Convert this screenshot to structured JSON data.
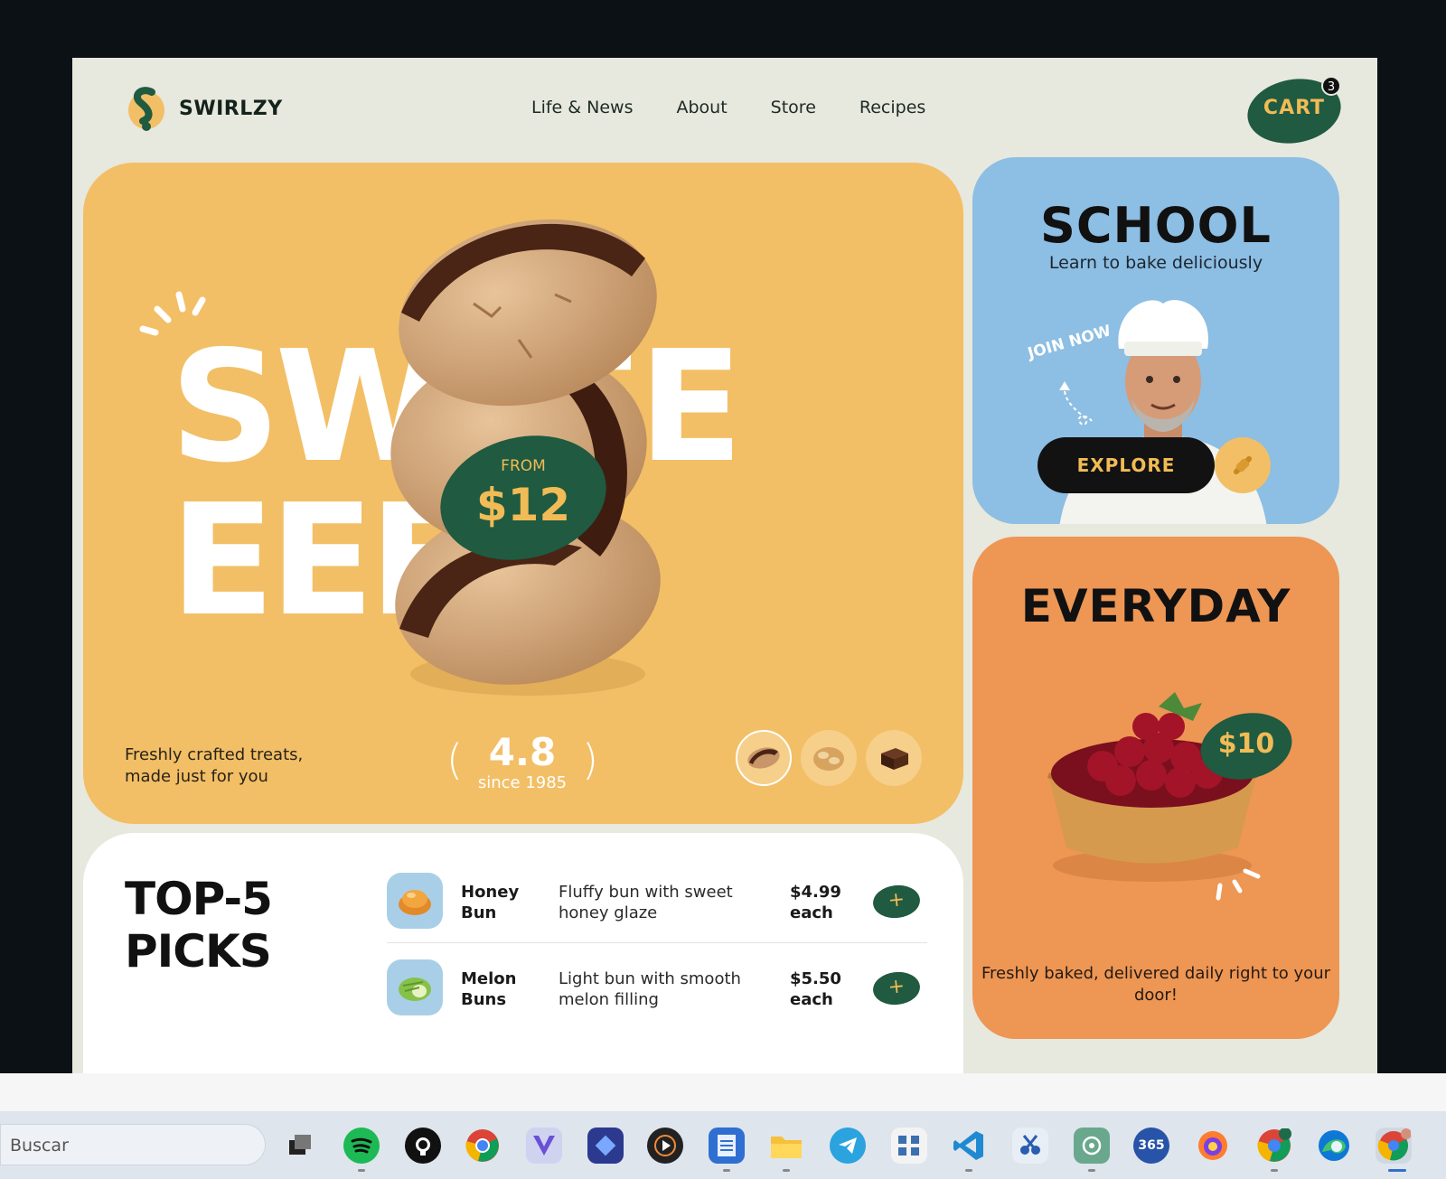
{
  "brand": {
    "name": "SWIRLZY"
  },
  "nav": [
    {
      "label": "Life & News"
    },
    {
      "label": "About"
    },
    {
      "label": "Store"
    },
    {
      "label": "Recipes"
    }
  ],
  "cart": {
    "label": "CART",
    "count": "3"
  },
  "hero": {
    "word_line1": "SWEEE",
    "word_line2": "EEET!",
    "price_from": "FROM",
    "price": "$12",
    "tagline": "Freshly crafted treats, made just for you",
    "rating": "4.8",
    "rating_sub": "since 1985",
    "thumbs": [
      "cookie-thumb-icon",
      "croissant-thumb-icon",
      "brownie-thumb-icon"
    ]
  },
  "picks": {
    "title_line1": "TOP-5",
    "title_line2": "PICKS",
    "items": [
      {
        "name": "Honey Bun",
        "desc": "Fluffy bun with sweet honey glaze",
        "price": "$4.99 each",
        "add": "+"
      },
      {
        "name": "Melon Buns",
        "desc": "Light bun with smooth melon filling",
        "price": "$5.50 each",
        "add": "+"
      }
    ]
  },
  "school": {
    "title": "SCHOOL",
    "subtitle": "Learn to bake deliciously",
    "join": "JOIN NOW",
    "explore": "EXPLORE"
  },
  "everyday": {
    "title": "EVERYDAY",
    "price": "$10",
    "caption": "Freshly baked, delivered daily right to your door!"
  },
  "taskbar": {
    "search_placeholder": "Buscar",
    "ms365_label": "365"
  },
  "colors": {
    "brand_green": "#1f5a41",
    "brand_yellow": "#f1bb55",
    "hero_bg": "#f2bf66",
    "school_bg": "#8dbee3",
    "everyday_bg": "#ee9654",
    "page_bg": "#e7e8de"
  }
}
